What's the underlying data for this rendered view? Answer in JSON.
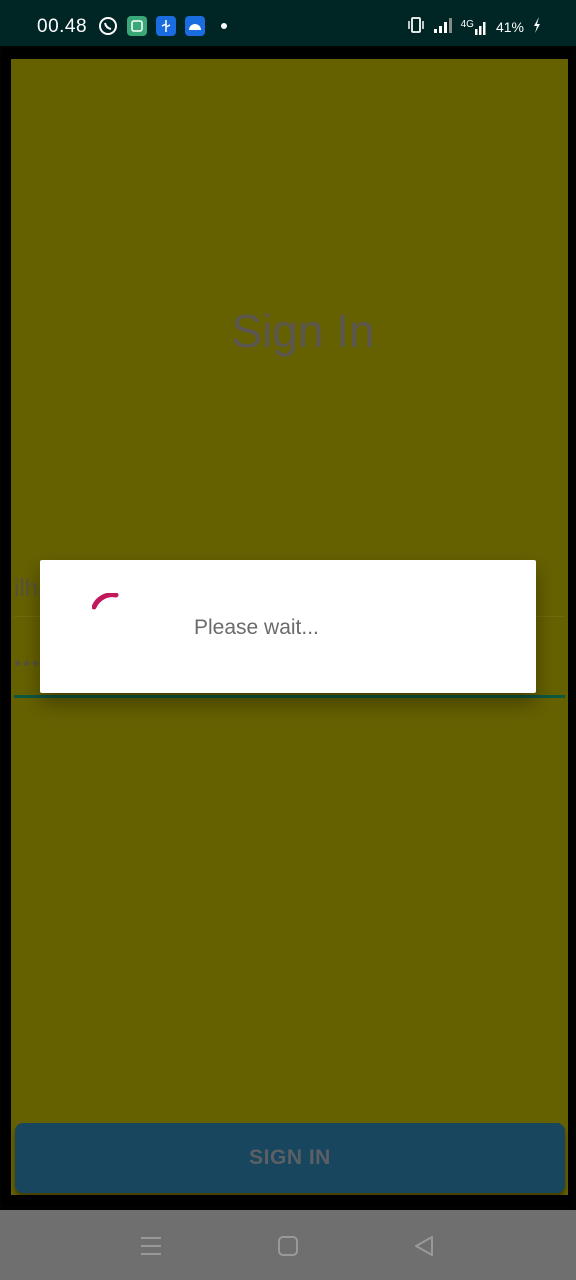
{
  "status_bar": {
    "time": "00.48",
    "battery": "41%",
    "network": "4G",
    "left_icons": [
      "whatsapp-icon",
      "app-icon-green",
      "usb-icon",
      "android-icon",
      "dot-icon"
    ],
    "right_icons": [
      "vibrate-icon",
      "signal-icon",
      "signal-4g-icon",
      "battery-charging-icon"
    ]
  },
  "app": {
    "title": "Sign In",
    "username": {
      "value": "ilh"
    },
    "password": {
      "value": "•••"
    },
    "signin_button_label": "SIGN IN"
  },
  "dialog": {
    "message": "Please wait..."
  },
  "nav_bar": {
    "buttons": [
      "menu-icon",
      "home-icon",
      "back-icon"
    ]
  },
  "colors": {
    "status_bar_bg": "#002525",
    "app_bg": "#666100",
    "button_bg": "#18465e",
    "spinner": "#c2185b",
    "nav_bg": "#6f6f6f"
  }
}
